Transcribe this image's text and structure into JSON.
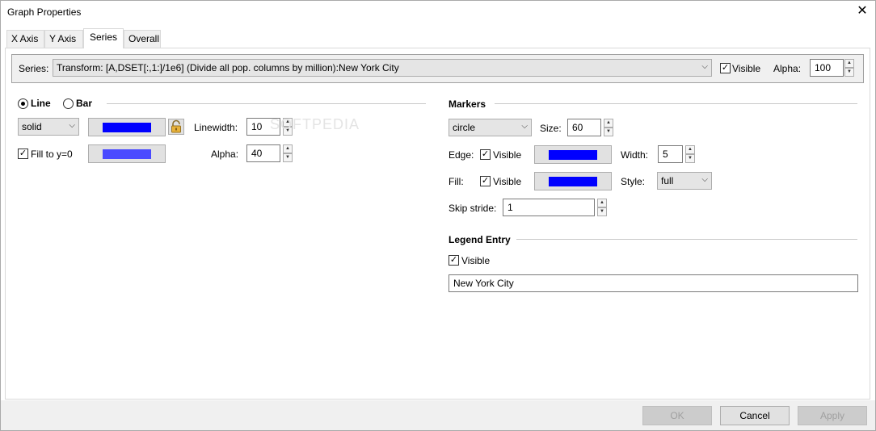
{
  "window": {
    "title": "Graph Properties",
    "close_symbol": "✕"
  },
  "tabs": [
    {
      "label": "X Axis"
    },
    {
      "label": "Y Axis"
    },
    {
      "label": "Series"
    },
    {
      "label": "Overall"
    }
  ],
  "series_bar": {
    "label": "Series:",
    "selected": "Transform: [A,DSET[:,1:]/1e6] (Divide all pop. columns by million):New York City",
    "visible_label": "Visible",
    "visible_checked": true,
    "alpha_label": "Alpha:",
    "alpha_value": "100"
  },
  "line": {
    "line_label": "Line",
    "bar_label": "Bar",
    "line_selected": true,
    "style_value": "solid",
    "line_color": "#0000ff",
    "linewidth_label": "Linewidth:",
    "linewidth_value": "10",
    "fill_label": "Fill to y=0",
    "fill_checked": true,
    "fill_color": "#4a4aff",
    "alpha_label": "Alpha:",
    "alpha_value": "40"
  },
  "watermark": "SOFTPEDIA",
  "markers": {
    "heading": "Markers",
    "shape_value": "circle",
    "size_label": "Size:",
    "size_value": "60",
    "edge_label": "Edge:",
    "edge_visible_label": "Visible",
    "edge_visible_checked": true,
    "edge_color": "#0000ff",
    "width_label": "Width:",
    "width_value": "5",
    "fill_label": "Fill:",
    "fill_visible_label": "Visible",
    "fill_visible_checked": true,
    "fill_color": "#0000ff",
    "style_label": "Style:",
    "style_value": "full",
    "skip_label": "Skip stride:",
    "skip_value": "1"
  },
  "legend": {
    "heading": "Legend Entry",
    "visible_label": "Visible",
    "visible_checked": true,
    "entry_value": "New York City"
  },
  "footer": {
    "ok_label": "OK",
    "cancel_label": "Cancel",
    "apply_label": "Apply"
  },
  "icons": {
    "checkmark": "✓",
    "dropdown": "⌵",
    "spin_up": "▲",
    "spin_down": "▼"
  }
}
